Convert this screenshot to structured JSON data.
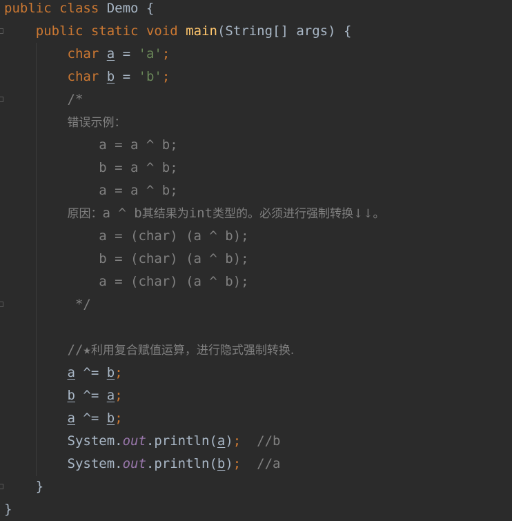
{
  "lines": [
    {
      "name": "line-class-decl",
      "indent": "",
      "tokens": [
        {
          "t": "public",
          "c": "kw"
        },
        {
          "t": " "
        },
        {
          "t": "class",
          "c": "kw"
        },
        {
          "t": " Demo {"
        }
      ]
    },
    {
      "name": "line-main-decl",
      "indent": "    ",
      "tokens": [
        {
          "t": "public",
          "c": "kw"
        },
        {
          "t": " "
        },
        {
          "t": "static",
          "c": "kw"
        },
        {
          "t": " "
        },
        {
          "t": "void",
          "c": "kw"
        },
        {
          "t": " "
        },
        {
          "t": "main",
          "c": "fn"
        },
        {
          "t": "(String[] args) {"
        }
      ]
    },
    {
      "name": "line-char-a",
      "indent": "        ",
      "tokens": [
        {
          "t": "char",
          "c": "kw"
        },
        {
          "t": " "
        },
        {
          "t": "a",
          "c": "var-u"
        },
        {
          "t": " = "
        },
        {
          "t": "'a'",
          "c": "str"
        },
        {
          "t": ";",
          "c": "kw"
        }
      ]
    },
    {
      "name": "line-char-b",
      "indent": "        ",
      "tokens": [
        {
          "t": "char",
          "c": "kw"
        },
        {
          "t": " "
        },
        {
          "t": "b",
          "c": "var-u"
        },
        {
          "t": " = "
        },
        {
          "t": "'b'",
          "c": "str"
        },
        {
          "t": ";",
          "c": "kw"
        }
      ]
    },
    {
      "name": "line-comment-open",
      "indent": "        ",
      "tokens": [
        {
          "t": "/*",
          "c": "cm"
        }
      ]
    },
    {
      "name": "line-comment-wrong-example",
      "indent": "        ",
      "tokens": [
        {
          "t": "错误示例：",
          "c": "cm cm-cjk"
        }
      ]
    },
    {
      "name": "line-comment-code-1",
      "indent": "            ",
      "tokens": [
        {
          "t": "a = a ^ b;",
          "c": "cm"
        }
      ]
    },
    {
      "name": "line-comment-code-2",
      "indent": "            ",
      "tokens": [
        {
          "t": "b = a ^ b;",
          "c": "cm"
        }
      ]
    },
    {
      "name": "line-comment-code-3",
      "indent": "            ",
      "tokens": [
        {
          "t": "a = a ^ b;",
          "c": "cm"
        }
      ]
    },
    {
      "name": "line-comment-reason",
      "indent": "        ",
      "tokens": [
        {
          "t": "原因：",
          "c": "cm cm-cjk"
        },
        {
          "t": "a ^ b",
          "c": "cm"
        },
        {
          "t": "其结果为",
          "c": "cm cm-cjk"
        },
        {
          "t": "int",
          "c": "cm"
        },
        {
          "t": "类型的。必须进行强制转换↓↓。",
          "c": "cm cm-cjk"
        }
      ]
    },
    {
      "name": "line-comment-cast-1",
      "indent": "            ",
      "tokens": [
        {
          "t": "a = (char) (a ^ b);",
          "c": "cm"
        }
      ]
    },
    {
      "name": "line-comment-cast-2",
      "indent": "            ",
      "tokens": [
        {
          "t": "b = (char) (a ^ b);",
          "c": "cm"
        }
      ]
    },
    {
      "name": "line-comment-cast-3",
      "indent": "            ",
      "tokens": [
        {
          "t": "a = (char) (a ^ b);",
          "c": "cm"
        }
      ]
    },
    {
      "name": "line-comment-close",
      "indent": "         ",
      "tokens": [
        {
          "t": "*/",
          "c": "cm"
        }
      ]
    },
    {
      "name": "line-empty",
      "indent": "",
      "tokens": []
    },
    {
      "name": "line-comment-compound",
      "indent": "        ",
      "tokens": [
        {
          "t": "//★",
          "c": "cm"
        },
        {
          "t": "利用复合赋值运算，进行隐式强制转换.",
          "c": "cm cm-cjk"
        }
      ]
    },
    {
      "name": "line-xor-a-1",
      "indent": "        ",
      "tokens": [
        {
          "t": "a",
          "c": "var-u"
        },
        {
          "t": " ^= "
        },
        {
          "t": "b",
          "c": "var-u"
        },
        {
          "t": ";",
          "c": "kw"
        }
      ]
    },
    {
      "name": "line-xor-b",
      "indent": "        ",
      "tokens": [
        {
          "t": "b",
          "c": "var-u"
        },
        {
          "t": " ^= "
        },
        {
          "t": "a",
          "c": "var-u"
        },
        {
          "t": ";",
          "c": "kw"
        }
      ]
    },
    {
      "name": "line-xor-a-2",
      "indent": "        ",
      "tokens": [
        {
          "t": "a",
          "c": "var-u"
        },
        {
          "t": " ^= "
        },
        {
          "t": "b",
          "c": "var-u"
        },
        {
          "t": ";",
          "c": "kw"
        }
      ]
    },
    {
      "name": "line-println-a",
      "indent": "        ",
      "tokens": [
        {
          "t": "System."
        },
        {
          "t": "out",
          "c": "field"
        },
        {
          "t": ".println("
        },
        {
          "t": "a",
          "c": "var-u"
        },
        {
          "t": ")"
        },
        {
          "t": ";",
          "c": "kw"
        },
        {
          "t": "  "
        },
        {
          "t": "//b",
          "c": "cm"
        }
      ]
    },
    {
      "name": "line-println-b",
      "indent": "        ",
      "tokens": [
        {
          "t": "System."
        },
        {
          "t": "out",
          "c": "field"
        },
        {
          "t": ".println("
        },
        {
          "t": "b",
          "c": "var-u"
        },
        {
          "t": ")"
        },
        {
          "t": ";",
          "c": "kw"
        },
        {
          "t": "  "
        },
        {
          "t": "//a",
          "c": "cm"
        }
      ]
    },
    {
      "name": "line-close-main",
      "indent": "    ",
      "tokens": [
        {
          "t": "}"
        }
      ]
    },
    {
      "name": "line-close-class",
      "indent": "",
      "tokens": [
        {
          "t": "}"
        }
      ]
    }
  ]
}
